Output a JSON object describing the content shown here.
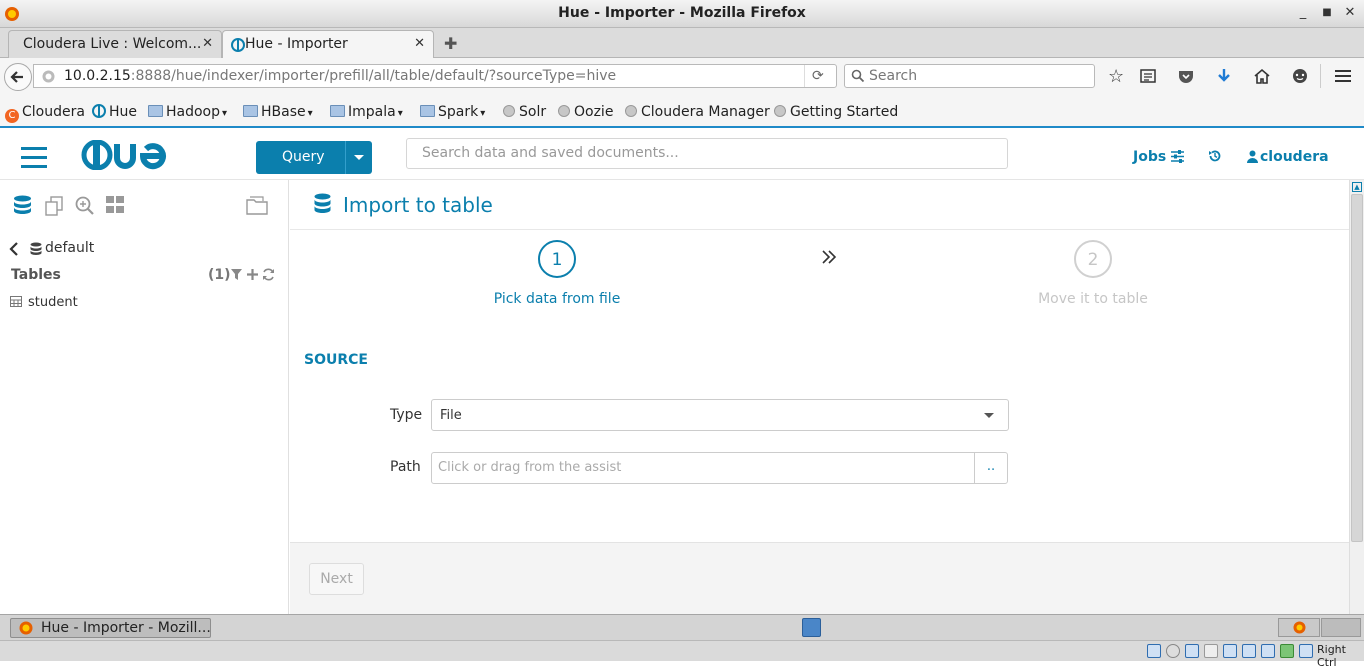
{
  "window": {
    "title": "Hue - Importer - Mozilla Firefox"
  },
  "tabs": [
    {
      "label": "Cloudera Live : Welcom...",
      "active": false
    },
    {
      "label": "Hue - Importer",
      "active": true
    }
  ],
  "navbar": {
    "url_host": "10.0.2.15",
    "url_rest": ":8888/hue/indexer/importer/prefill/all/table/default/?sourceType=hive",
    "search_placeholder": "Search"
  },
  "bookmarks": [
    {
      "label": "Cloudera",
      "kind": "cloudera-favicon"
    },
    {
      "label": "Hue",
      "kind": "hue-favicon"
    },
    {
      "label": "Hadoop",
      "kind": "folder",
      "menu": true
    },
    {
      "label": "HBase",
      "kind": "folder",
      "menu": true
    },
    {
      "label": "Impala",
      "kind": "folder",
      "menu": true
    },
    {
      "label": "Spark",
      "kind": "folder",
      "menu": true
    },
    {
      "label": "Solr",
      "kind": "globe"
    },
    {
      "label": "Oozie",
      "kind": "globe"
    },
    {
      "label": "Cloudera Manager",
      "kind": "globe"
    },
    {
      "label": "Getting Started",
      "kind": "globe"
    }
  ],
  "hue_header": {
    "logo": "HUE",
    "query_button": "Query",
    "search_placeholder": "Search data and saved documents...",
    "jobs_label": "Jobs",
    "user_label": "cloudera"
  },
  "sidebar": {
    "database": "default",
    "tables_label": "Tables",
    "tables_count": "(1)",
    "tables": [
      "student"
    ]
  },
  "page": {
    "title": "Import to table",
    "steps": [
      {
        "number": "1",
        "label": "Pick data from file",
        "active": true
      },
      {
        "number": "2",
        "label": "Move it to table",
        "active": false
      }
    ],
    "section_label": "SOURCE",
    "type_label": "Type",
    "type_value": "File",
    "path_label": "Path",
    "path_placeholder": "Click or drag from the assist",
    "path_button": "..",
    "next_button": "Next"
  },
  "taskbar": {
    "window_button": "Hue - Importer - Mozill..."
  },
  "statusbar": {
    "right_text": "Right Ctrl"
  },
  "colors": {
    "accent": "#0B7FAD",
    "inactive_step": "#cccccc"
  }
}
